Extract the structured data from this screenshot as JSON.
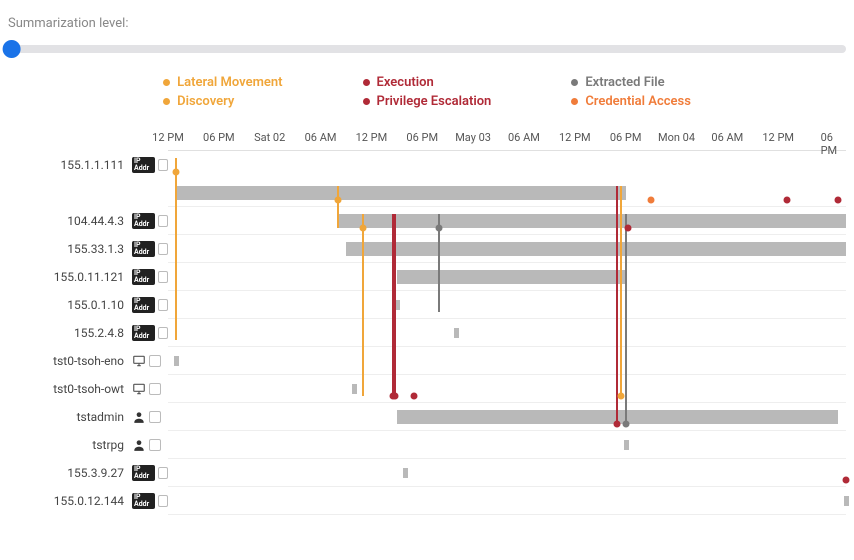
{
  "slider": {
    "label": "Summarization level:"
  },
  "legend": {
    "col1": [
      {
        "label": "Lateral Movement",
        "color": "#f0a63a"
      },
      {
        "label": "Discovery",
        "color": "#f0a63a"
      }
    ],
    "col2": [
      {
        "label": "Execution",
        "color": "#b02a37"
      },
      {
        "label": "Privilege Escalation",
        "color": "#b02a37"
      }
    ],
    "col3": [
      {
        "label": "Extracted File",
        "color": "#7a7a7a"
      },
      {
        "label": "Credential Access",
        "color": "#f07c3a"
      }
    ]
  },
  "colors": {
    "lateral": "#f0a63a",
    "execution": "#b02a37",
    "extracted": "#7a7a7a",
    "credential": "#f07c3a",
    "bar": "#b9b9b9"
  },
  "chart_data": {
    "type": "timeline-swimlane",
    "x_unit": "hours since May 01 12:00",
    "x_range_hours": [
      0,
      80
    ],
    "ticks": [
      {
        "t": 0,
        "label": "12 PM"
      },
      {
        "t": 6,
        "label": "06 PM"
      },
      {
        "t": 12,
        "label": "Sat 02"
      },
      {
        "t": 18,
        "label": "06 AM"
      },
      {
        "t": 24,
        "label": "12 PM"
      },
      {
        "t": 30,
        "label": "06 PM"
      },
      {
        "t": 36,
        "label": "May 03"
      },
      {
        "t": 42,
        "label": "06 AM"
      },
      {
        "t": 48,
        "label": "12 PM"
      },
      {
        "t": 54,
        "label": "06 PM"
      },
      {
        "t": 60,
        "label": "Mon 04"
      },
      {
        "t": 66,
        "label": "06 AM"
      },
      {
        "t": 72,
        "label": "12 PM"
      },
      {
        "t": 78,
        "label": "06 PM"
      }
    ],
    "rows": [
      {
        "id": "155.1.1.111",
        "kind": "ip",
        "bars": [
          {
            "t0": 1,
            "t1": 54
          }
        ],
        "segs": []
      },
      {
        "id": "104.44.4.3",
        "kind": "ip",
        "bars": [
          {
            "t0": 20,
            "t1": 80
          }
        ],
        "segs": []
      },
      {
        "id": "155.33.1.3",
        "kind": "ip",
        "bars": [
          {
            "t0": 21,
            "t1": 80
          }
        ],
        "segs": []
      },
      {
        "id": "155.0.11.121",
        "kind": "ip",
        "bars": [
          {
            "t0": 27,
            "t1": 54
          }
        ],
        "segs": []
      },
      {
        "id": "155.0.1.10",
        "kind": "ip",
        "bars": [],
        "segs": [
          {
            "t": 27
          }
        ]
      },
      {
        "id": "155.2.4.8",
        "kind": "ip",
        "bars": [],
        "segs": [
          {
            "t": 34
          }
        ]
      },
      {
        "id": "tst0-tsoh-eno",
        "kind": "host",
        "bars": [],
        "segs": [
          {
            "t": 1
          }
        ]
      },
      {
        "id": "tst0-tsoh-owt",
        "kind": "host",
        "bars": [],
        "segs": [
          {
            "t": 22
          }
        ]
      },
      {
        "id": "tstadmin",
        "kind": "user",
        "bars": [
          {
            "t0": 27,
            "t1": 79
          }
        ],
        "segs": []
      },
      {
        "id": "tstrpg",
        "kind": "user",
        "bars": [],
        "segs": [
          {
            "t": 54
          }
        ]
      },
      {
        "id": "155.3.9.27",
        "kind": "ip",
        "bars": [],
        "segs": [
          {
            "t": 28
          }
        ]
      },
      {
        "id": "155.0.12.144",
        "kind": "ip",
        "bars": [],
        "segs": [
          {
            "t": 80
          }
        ]
      }
    ],
    "events": [
      {
        "t": 1,
        "row_from": 0,
        "row_to": 6,
        "type": "lateral",
        "dot_at": "from"
      },
      {
        "t": 20,
        "row_from": 1,
        "row_to": 2,
        "type": "lateral",
        "dot_at": "from"
      },
      {
        "t": 23,
        "row_from": 2,
        "row_to": 8,
        "type": "lateral",
        "dot_at": "from"
      },
      {
        "t": 26.5,
        "row_from": 2,
        "row_to": 8,
        "type": "execution",
        "dot_at": "to"
      },
      {
        "t": 26.8,
        "row_from": 2,
        "row_to": 8,
        "type": "execution",
        "dot_at": "to"
      },
      {
        "t": 32,
        "row_from": 2,
        "row_to": 5,
        "type": "extracted",
        "dot_at": "from"
      },
      {
        "t": 53,
        "row_from": 1,
        "row_to": 9,
        "type": "execution",
        "dot_at": "to"
      },
      {
        "t": 53.5,
        "row_from": 1,
        "row_to": 8,
        "type": "lateral",
        "dot_at": "to"
      },
      {
        "t": 54,
        "row_from": 2,
        "row_to": 9,
        "type": "extracted",
        "dot_at": "to"
      },
      {
        "t": 54.3,
        "row_from": 2,
        "row_to": 2,
        "type": "execution",
        "dot_at": "from"
      },
      {
        "t": 57,
        "row_from": 1,
        "row_to": 1,
        "type": "credential",
        "dot_at": "from"
      },
      {
        "t": 73,
        "row_from": 1,
        "row_to": 1,
        "type": "execution",
        "dot_at": "from"
      },
      {
        "t": 79,
        "row_from": 1,
        "row_to": 1,
        "type": "execution",
        "dot_at": "from"
      },
      {
        "t": 80,
        "row_from": 11,
        "row_to": 11,
        "type": "execution",
        "dot_at": "from"
      },
      {
        "t": 29,
        "row_from": 8,
        "row_to": 8,
        "type": "execution",
        "dot_at": "from"
      }
    ]
  }
}
